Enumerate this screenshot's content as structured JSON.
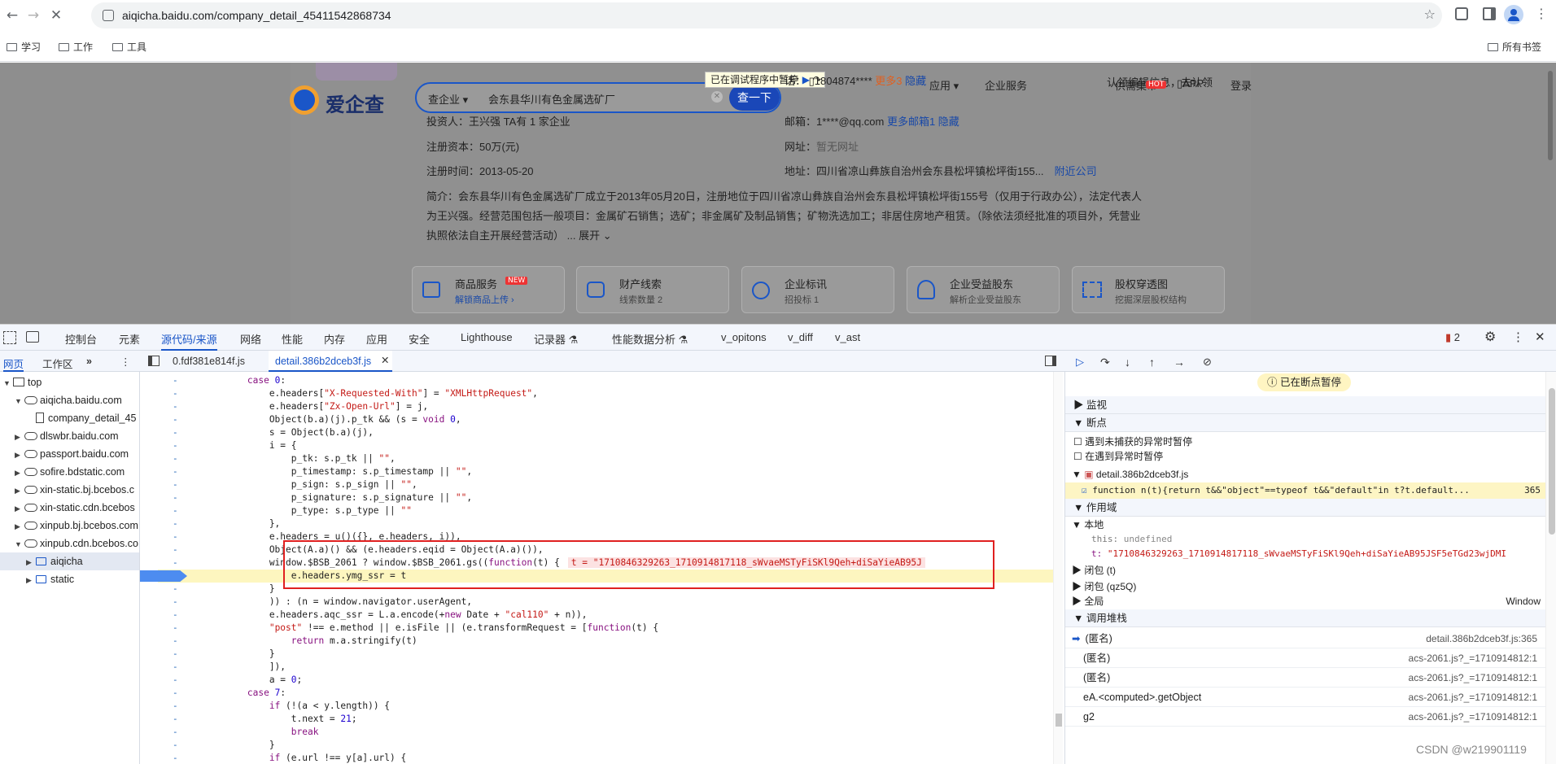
{
  "browser": {
    "url": "aiqicha.baidu.com/company_detail_45411542868734",
    "bookmarks": [
      "学习",
      "工作",
      "工具"
    ],
    "all_bookmarks": "所有书签"
  },
  "page": {
    "logo": "爱企查",
    "search_scope": "查企业",
    "search_value": "会东县华川有色金属选矿厂",
    "search_button": "查一下",
    "paused_banner": "已在调试程序中暂停",
    "nav": {
      "cert": "认领编辑信息，去认领",
      "apply": "应用",
      "enterprise": "企业服务",
      "supply": "供需集市",
      "hot": "HOT",
      "app": "APP",
      "login": "登录"
    },
    "info": {
      "investor": "投资人：王兴强  TA有 1 家企业",
      "phone_label": "话：",
      "phone": "1804874****",
      "more_phone": "更多3",
      "hide1": "隐藏",
      "email_label": "邮箱：",
      "email": "1****@qq.com",
      "more_email": "更多邮箱1",
      "hide2": "隐藏",
      "capital_label": "注册资本：",
      "capital": "50万(元)",
      "site_label": "网址：",
      "site": "暂无网址",
      "date_label": "注册时间：",
      "date": "2013-05-20",
      "addr_label": "地址：",
      "addr": "四川省凉山彝族自治州会东县松坪镇松坪街155...",
      "nearby": "附近公司",
      "intro1": "简介：会东县华川有色金属选矿厂成立于2013年05月20日，注册地位于四川省凉山彝族自治州会东县松坪镇松坪街155号（仅用于行政办公），法定代表人",
      "intro2": "为王兴强。经营范围包括一般项目：金属矿石销售；选矿；非金属矿及制品销售；矿物洗选加工；非居住房地产租赁。（除依法须经批准的项目外，凭营业",
      "intro3": "执照依法自主开展经营活动）",
      "expand": "... 展开"
    },
    "features": [
      {
        "title": "商品服务",
        "badge": "NEW",
        "sub": "解锁商品上传 ›"
      },
      {
        "title": "财产线索",
        "sub": "线索数量 2"
      },
      {
        "title": "企业标讯",
        "sub": "招投标 1"
      },
      {
        "title": "企业受益股东",
        "sub": "解析企业受益股东"
      },
      {
        "title": "股权穿透图",
        "sub": "挖掘深层股权结构"
      }
    ]
  },
  "devtools": {
    "tabs": [
      "控制台",
      "元素",
      "源代码/来源",
      "网络",
      "性能",
      "内存",
      "应用",
      "安全",
      "Lighthouse",
      "记录器",
      "性能数据分析",
      "v_opitons",
      "v_diff",
      "v_ast"
    ],
    "issues": "2",
    "subtabs": {
      "page": "网页",
      "workspace": "工作区",
      "file1": "0.fdf381e814f.js",
      "file2": "detail.386b2dceb3f.js"
    },
    "tree": [
      {
        "label": "top",
        "indent": 0,
        "arrow": "▼",
        "icon": "frame"
      },
      {
        "label": "aiqicha.baidu.com",
        "indent": 1,
        "arrow": "▼",
        "icon": "cloud"
      },
      {
        "label": "company_detail_45",
        "indent": 2,
        "arrow": "",
        "icon": "file"
      },
      {
        "label": "dlswbr.baidu.com",
        "indent": 1,
        "arrow": "▶",
        "icon": "cloud"
      },
      {
        "label": "passport.baidu.com",
        "indent": 1,
        "arrow": "▶",
        "icon": "cloud"
      },
      {
        "label": "sofire.bdstatic.com",
        "indent": 1,
        "arrow": "▶",
        "icon": "cloud"
      },
      {
        "label": "xin-static.bj.bcebos.c",
        "indent": 1,
        "arrow": "▶",
        "icon": "cloud"
      },
      {
        "label": "xin-static.cdn.bcebos",
        "indent": 1,
        "arrow": "▶",
        "icon": "cloud"
      },
      {
        "label": "xinpub.bj.bcebos.com",
        "indent": 1,
        "arrow": "▶",
        "icon": "cloud"
      },
      {
        "label": "xinpub.cdn.bcebos.co",
        "indent": 1,
        "arrow": "▼",
        "icon": "cloud"
      },
      {
        "label": "aiqicha",
        "indent": 2,
        "arrow": "▶",
        "icon": "folder"
      },
      {
        "label": "static",
        "indent": 2,
        "arrow": "▶",
        "icon": "folder"
      }
    ],
    "code": [
      {
        "t": "        case 0:",
        "k": 1
      },
      {
        "t": "            e.headers[\"X-Requested-With\"] = \"XMLHttpRequest\","
      },
      {
        "t": "            e.headers[\"Zx-Open-Url\"] = j,"
      },
      {
        "t": "            Object(b.a)(j).p_tk && (s = void 0,"
      },
      {
        "t": "            s = Object(b.a)(j),"
      },
      {
        "t": "            i = {"
      },
      {
        "t": "                p_tk: s.p_tk || \"\","
      },
      {
        "t": "                p_timestamp: s.p_timestamp || \"\","
      },
      {
        "t": "                p_sign: s.p_sign || \"\","
      },
      {
        "t": "                p_signature: s.p_signature || \"\","
      },
      {
        "t": "                p_type: s.p_type || \"\""
      },
      {
        "t": "            },"
      },
      {
        "t": "            e.headers = u()({}, e.headers, i)),"
      },
      {
        "t": "            Object(A.a)() && (e.headers.eqid = Object(A.a)()),"
      },
      {
        "t": "            window.$BSB_2061 ? window.$BSB_2061.gs((function(t) {"
      },
      {
        "t": "                e.headers.ymg_ssr = t",
        "hl": 1
      },
      {
        "t": "            }"
      },
      {
        "t": "            )) : (n = window.navigator.userAgent,"
      },
      {
        "t": "            e.headers.aqc_ssr = L.a.encode(+new Date + \"cal110\" + n)),"
      },
      {
        "t": "            \"post\" !== e.method || e.isFile || (e.transformRequest = [function(t) {"
      },
      {
        "t": "                return m.a.stringify(t)"
      },
      {
        "t": "            }"
      },
      {
        "t": "            ]),"
      },
      {
        "t": "            a = 0;"
      },
      {
        "t": "        case 7:",
        "k": 1
      },
      {
        "t": "            if (!(a < y.length)) {"
      },
      {
        "t": "                t.next = 21;"
      },
      {
        "t": "                break"
      },
      {
        "t": "            }"
      },
      {
        "t": "            if (e.url !== y[a].url) {"
      }
    ],
    "inline_value": "t = \"1710846329263_1710914817118_sWvaeMSTyFiSKl9Qeh+diSaYieAB95J",
    "debugger": {
      "paused": "已在断点暂停",
      "watch": "监视",
      "breakpoints": "断点",
      "bp_uncaught": "遇到未捕获的异常时暂停",
      "bp_caught": "在遇到异常时暂停",
      "bp_file": "detail.386b2dceb3f.js",
      "bp_code": "function n(t){return t&&\"object\"==typeof t&&\"default\"in t?t.default...",
      "bp_line": "365",
      "scope": "作用域",
      "local": "本地",
      "this_label": "this:",
      "this_val": "undefined",
      "t_label": "t:",
      "t_val": "\"1710846329263_1710914817118_sWvaeMSTyFiSKl9Qeh+diSaYieAB95JSF5eTGd23wjDMI",
      "closure1": "闭包 (t)",
      "closure2": "闭包 (qz5Q)",
      "global": "全局",
      "global_val": "Window",
      "callstack": "调用堆栈",
      "frames": [
        {
          "name": "(匿名)",
          "loc": "detail.386b2dceb3f.js:365",
          "active": 1
        },
        {
          "name": "(匿名)",
          "loc": "acs-2061.js?_=1710914812:1"
        },
        {
          "name": "(匿名)",
          "loc": "acs-2061.js?_=1710914812:1"
        },
        {
          "name": "eA.<computed>.getObject",
          "loc": "acs-2061.js?_=1710914812:1"
        },
        {
          "name": "g2",
          "loc": "acs-2061.js?_=1710914812:1"
        }
      ]
    },
    "watermark": "CSDN @w219901119"
  }
}
